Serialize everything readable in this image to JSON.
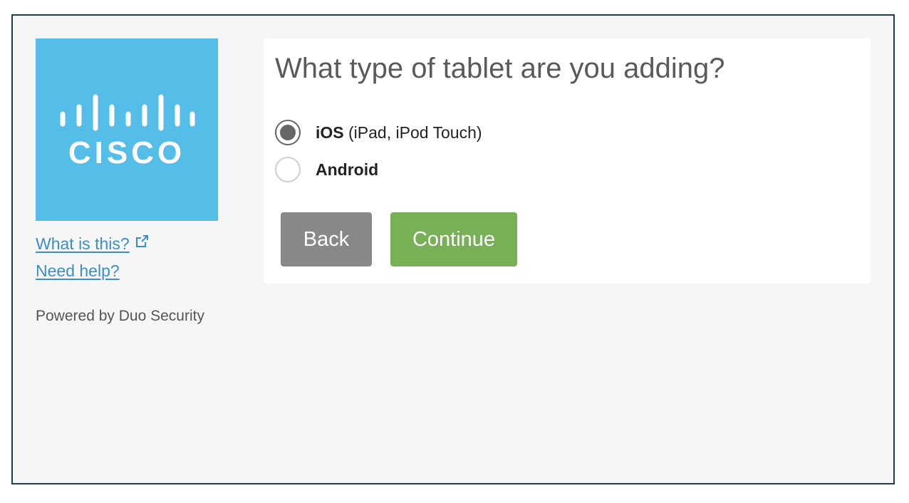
{
  "sidebar": {
    "logo": {
      "icon": "cisco-logo",
      "text": "CISCO",
      "background": "#54bde8"
    },
    "what_is_this": "What is this?",
    "need_help": "Need help?",
    "powered_by": "Powered by Duo Security"
  },
  "main": {
    "title": "What type of tablet are you adding?",
    "options": [
      {
        "name": "iOS",
        "detail": " (iPad, iPod Touch)",
        "selected": true
      },
      {
        "name": "Android",
        "detail": "",
        "selected": false
      }
    ],
    "back_label": "Back",
    "continue_label": "Continue"
  },
  "colors": {
    "link": "#3a8fc7",
    "back_button": "#888888",
    "continue_button": "#77b055",
    "frame_border": "#1f3a52"
  }
}
